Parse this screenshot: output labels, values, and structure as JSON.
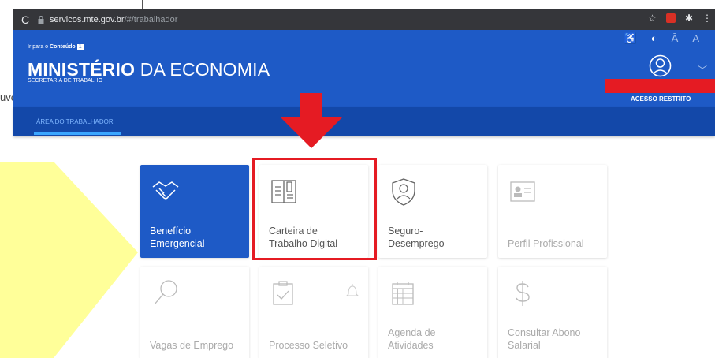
{
  "browser": {
    "url_domain": "servicos.mte.gov.br",
    "url_path": "/#/trabalhador"
  },
  "header": {
    "skip_prefix": "Ir para o",
    "skip_link": "Conteúdo",
    "skip_key": "1",
    "ministry_bold": "MINISTÉRIO",
    "ministry_rest": " DA ECONOMIA",
    "secretaria": "SECRETARIA DE TRABALHO",
    "access": "ACESSO RESTRITO",
    "font_decrease": "Ā",
    "font_increase": "A"
  },
  "background": {
    "left_text": "uve"
  },
  "nav": {
    "active_tab": "ÁREA DO TRABALHADOR"
  },
  "tiles": [
    {
      "label": "Benefício\nEmergencial",
      "icon": "handshake-icon",
      "state": "primary"
    },
    {
      "label": "Carteira de\nTrabalho Digital",
      "icon": "work-card-icon",
      "state": "highlighted"
    },
    {
      "label": "Seguro-\nDesemprego",
      "icon": "shield-person-icon",
      "state": "normal"
    },
    {
      "label": "Perfil Profissional",
      "icon": "profile-card-icon",
      "state": "disabled"
    },
    {
      "label": "Vagas de Emprego",
      "icon": "search-icon",
      "state": "disabled"
    },
    {
      "label": "Processo Seletivo",
      "icon": "clipboard-check-icon",
      "state": "disabled"
    },
    {
      "label": "Agenda de\nAtividades",
      "icon": "calendar-icon",
      "state": "disabled"
    },
    {
      "label": "Consultar Abono\nSalarial",
      "icon": "dollar-icon",
      "state": "disabled"
    }
  ],
  "colors": {
    "brand_blue": "#1e5ac6",
    "nav_blue": "#1348a9",
    "highlight_red": "#e51b23",
    "callout_yellow": "#ffff99"
  }
}
